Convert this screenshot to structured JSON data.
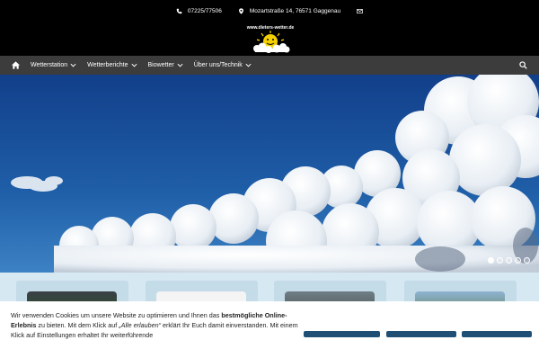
{
  "header": {
    "phone": "07225/77506",
    "address": "Mozartstraße 14, 76571 Gaggenau",
    "logo_text": "www.dieters-wetter.de",
    "phone_icon": "phone-icon",
    "address_icon": "map-pin-icon",
    "email_icon": "mail-icon"
  },
  "nav": {
    "home_icon": "home-icon",
    "items": [
      {
        "label": "Wetterstation"
      },
      {
        "label": "Wetterberichte"
      },
      {
        "label": "Biowetter"
      },
      {
        "label": "Über uns/Technik"
      }
    ],
    "search_icon": "search-icon"
  },
  "slider": {
    "slide_count": 5,
    "active_index": 0
  },
  "cookie": {
    "text_1": "Wir verwenden Cookies um unsere Website zu optimieren und Ihnen das ",
    "bold_1": "bestmögliche Online-Erlebnis",
    "text_2": " zu bieten. Mit dem Klick auf ",
    "italic_1": "„Alle erlauben“",
    "text_3": " erklärt Ihr Euch damit einverstanden. Mit einem Klick auf Einstellungen erhaltet Ihr weiterführende"
  },
  "colors": {
    "top_bar": "#000000",
    "nav_bar": "#3c3c3c",
    "sky": "#1f5fa8",
    "cards_bg": "#d6e8f2",
    "cookie_button": "#1f4f74"
  }
}
